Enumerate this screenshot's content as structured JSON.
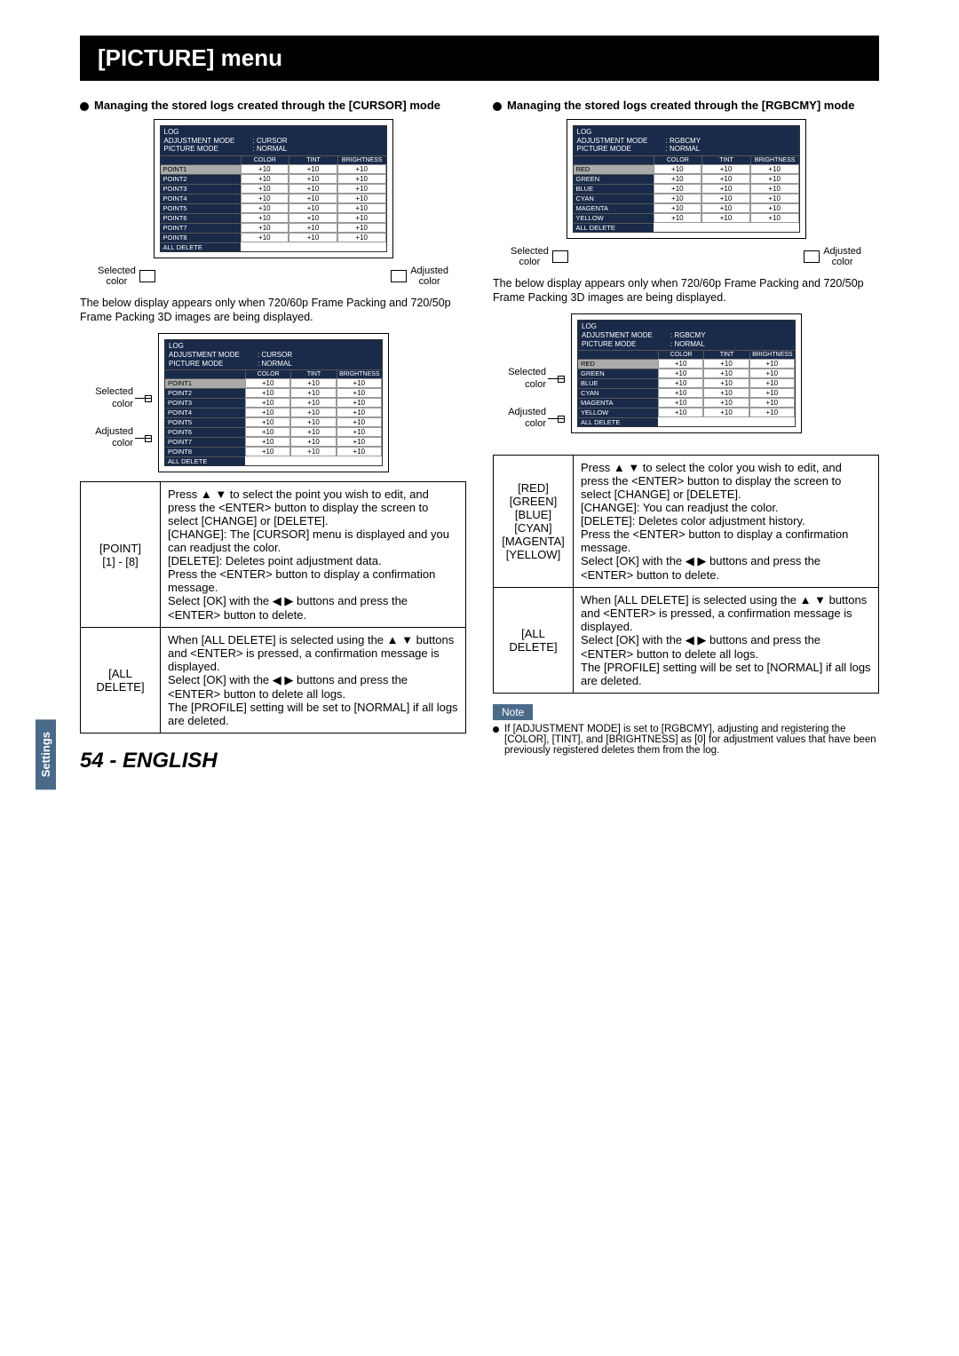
{
  "title": "[PICTURE] menu",
  "left": {
    "heading": "Managing the stored logs created through the [CURSOR] mode",
    "osd": {
      "log": "LOG",
      "adj_label": "ADJUSTMENT MODE",
      "adj_val": ": CURSOR",
      "pic_label": "PICTURE MODE",
      "pic_val": ": NORMAL",
      "col_color": "COLOR",
      "col_tint": "TINT",
      "col_bright": "BRIGHTNESS",
      "rows": [
        {
          "name": "POINT1",
          "c": "+10",
          "t": "+10",
          "b": "+10"
        },
        {
          "name": "POINT2",
          "c": "+10",
          "t": "+10",
          "b": "+10"
        },
        {
          "name": "POINT3",
          "c": "+10",
          "t": "+10",
          "b": "+10"
        },
        {
          "name": "POINT4",
          "c": "+10",
          "t": "+10",
          "b": "+10"
        },
        {
          "name": "POINT5",
          "c": "+10",
          "t": "+10",
          "b": "+10"
        },
        {
          "name": "POINT6",
          "c": "+10",
          "t": "+10",
          "b": "+10"
        },
        {
          "name": "POINT7",
          "c": "+10",
          "t": "+10",
          "b": "+10"
        },
        {
          "name": "POINT8",
          "c": "+10",
          "t": "+10",
          "b": "+10"
        }
      ],
      "all_delete": "ALL DELETE"
    },
    "swatch_selected": "Selected\ncolor",
    "swatch_adjusted": "Adjusted\ncolor",
    "desc": "The below display appears only when 720/60p Frame Packing and 720/50p Frame Packing 3D images are being displayed.",
    "side_selected": "Selected\ncolor",
    "side_adjusted": "Adjusted\ncolor",
    "table": {
      "row1_label": "[POINT]\n[1] - [8]",
      "row1_text": "Press  ▲ ▼  to select the point you wish to edit, and press the <ENTER> button to display the screen to select [CHANGE] or [DELETE].\n[CHANGE]: The [CURSOR] menu is displayed and you can readjust the color.\n[DELETE]: Deletes point adjustment data.\nPress the <ENTER> button to display a confirmation message.\nSelect [OK] with the  ◀ ▶  buttons and press the <ENTER> button to delete.",
      "row2_label": "[ALL DELETE]",
      "row2_text": "When [ALL DELETE] is selected using the  ▲ ▼  buttons and <ENTER> is pressed, a confirmation message is displayed.\nSelect [OK] with the  ◀ ▶  buttons and press the <ENTER> button to delete all logs.\nThe [PROFILE] setting will be set to [NORMAL] if all logs are deleted."
    }
  },
  "right": {
    "heading": "Managing the stored logs created through the [RGBCMY] mode",
    "osd": {
      "log": "LOG",
      "adj_label": "ADJUSTMENT MODE",
      "adj_val": ": RGBCMY",
      "pic_label": "PICTURE MODE",
      "pic_val": ": NORMAL",
      "col_color": "COLOR",
      "col_tint": "TINT",
      "col_bright": "BRIGHTNESS",
      "rows": [
        {
          "name": "RED",
          "c": "+10",
          "t": "+10",
          "b": "+10"
        },
        {
          "name": "GREEN",
          "c": "+10",
          "t": "+10",
          "b": "+10"
        },
        {
          "name": "BLUE",
          "c": "+10",
          "t": "+10",
          "b": "+10"
        },
        {
          "name": "CYAN",
          "c": "+10",
          "t": "+10",
          "b": "+10"
        },
        {
          "name": "MAGENTA",
          "c": "+10",
          "t": "+10",
          "b": "+10"
        },
        {
          "name": "YELLOW",
          "c": "+10",
          "t": "+10",
          "b": "+10"
        }
      ],
      "all_delete": "ALL DELETE"
    },
    "swatch_selected": "Selected\ncolor",
    "swatch_adjusted": "Adjusted\ncolor",
    "desc": "The below display appears only when 720/60p Frame Packing and 720/50p Frame Packing 3D images are being displayed.",
    "side_selected": "Selected\ncolor",
    "side_adjusted": "Adjusted\ncolor",
    "table": {
      "row1_label": "[RED]\n[GREEN]\n[BLUE]\n[CYAN]\n[MAGENTA]\n[YELLOW]",
      "row1_text": "Press  ▲ ▼  to select the color you wish to edit, and press the <ENTER> button to display the screen to select [CHANGE] or [DELETE].\n[CHANGE]: You can readjust the color.\n[DELETE]: Deletes color adjustment history.\nPress the <ENTER> button to display a confirmation message.\nSelect [OK] with the  ◀ ▶  buttons and press the <ENTER> button to delete.",
      "row2_label": "[ALL DELETE]",
      "row2_text": "When [ALL DELETE] is selected using the  ▲ ▼  buttons and <ENTER> is pressed, a confirmation message is displayed.\nSelect [OK] with the  ◀ ▶  buttons and press the <ENTER> button to delete all logs.\nThe [PROFILE] setting will be set to [NORMAL] if all logs are deleted."
    },
    "note_label": "Note",
    "note_text": "If [ADJUSTMENT MODE] is set to [RGBCMY], adjusting and registering the [COLOR], [TINT], and [BRIGHTNESS] as [0] for adjustment values that have been previously registered deletes them from the log."
  },
  "side_tab": "Settings",
  "footer": "54 - ENGLISH"
}
